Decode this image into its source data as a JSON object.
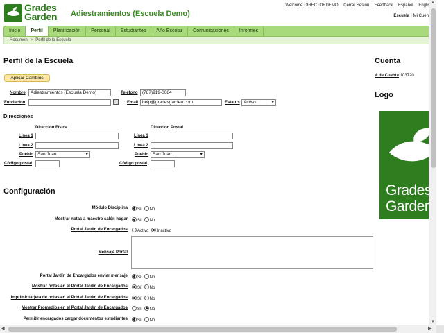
{
  "header": {
    "brand_line1": "Grades",
    "brand_line2": "Garden",
    "school_title": "Adiestramientos (Escuela Demo)",
    "welcome": "Welcome",
    "username": "DIRECTORDEMO",
    "logout": "Cerrar Sesión",
    "feedback": "Feedback",
    "lang_es": "Español",
    "lang_en": "English",
    "school_link": "Escuela",
    "account_link": "Mi Cuenta"
  },
  "nav": {
    "items": [
      "Inicio",
      "Perfil",
      "Planificación",
      "Personal",
      "Estudiantes",
      "Año Escolar",
      "Comunicaciones",
      "Informes"
    ],
    "active": "Perfil"
  },
  "breadcrumb": [
    "Resumen",
    "Perfil de la Escuela"
  ],
  "profile": {
    "heading": "Perfil de la Escuela",
    "apply_button": "Aplicar Cambios",
    "name_label": "Nombre",
    "name_value": "Adiestramientos (Escuela Demo)",
    "phone_label": "Teléfono",
    "phone_value": "(787)919-0084",
    "founded_label": "Fundación",
    "founded_value": "",
    "email_label": "Email",
    "email_value": "help@gradesgarden.com",
    "status_label": "Estatus",
    "status_value": "Activo"
  },
  "addresses": {
    "heading": "Direcciones",
    "physical_heading": "Dirección Física",
    "postal_heading": "Dirección Postal",
    "line1_label": "Línea 1",
    "line2_label": "Línea 2",
    "town_label": "Pueblo",
    "zip_label": "Código postal",
    "physical_town": "San Juan",
    "postal_town": "San Juan"
  },
  "config": {
    "heading": "Configuración",
    "yes": "Sí",
    "no": "No",
    "active": "Activo",
    "inactive": "Inactivo",
    "rows": [
      {
        "label": "Módulo Disciplina",
        "value": "yes"
      },
      {
        "label": "Mostrar notas a maestro salón hogar",
        "value": "yes"
      },
      {
        "label": "Portal Jardín de Encargados",
        "value": "inactive"
      },
      {
        "label": "Mensaje Portal",
        "value": ""
      },
      {
        "label": "Portal Jardín de Encargados enviar mensaje",
        "value": "yes"
      },
      {
        "label": "Mostrar notas en el Portal Jardín de Encargados",
        "value": "yes"
      },
      {
        "label": "Imprimir tarjeta de notas en el Portal Jardín de Encargados",
        "value": "yes"
      },
      {
        "label": "Mostrar Promedios en el Portal Jardín de Encargados",
        "value": "no"
      },
      {
        "label": "Permitir encargados cargar documentos estudiantes",
        "value": "yes"
      }
    ]
  },
  "account": {
    "heading": "Cuenta",
    "number_label": "# de Cuenta",
    "number_value": "103720",
    "logo_heading": "Logo",
    "logo_word1": "Grades",
    "logo_word2": "Garden"
  },
  "colors": {
    "brand_green": "#2e7d1f",
    "nav_green": "#a8d97a",
    "apply_yellow": "#fde7a3"
  }
}
